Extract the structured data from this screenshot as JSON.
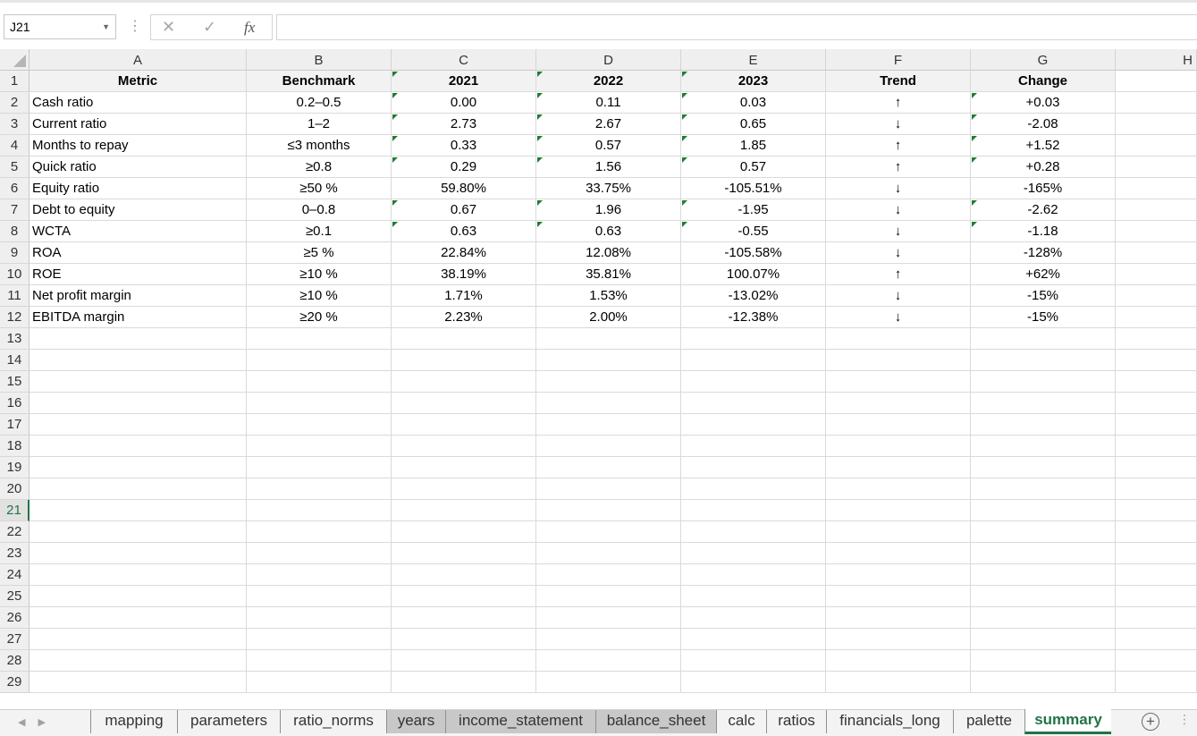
{
  "formula_bar": {
    "name_box": "J21",
    "formula": ""
  },
  "columns": [
    "A",
    "B",
    "C",
    "D",
    "E",
    "F",
    "G",
    "H"
  ],
  "header_row": [
    "Metric",
    "Benchmark",
    "2021",
    "2022",
    "2023",
    "Trend",
    "Change"
  ],
  "rows": [
    [
      "Cash ratio",
      "0.2–0.5",
      "0.00",
      "0.11",
      "0.03",
      "↑",
      "+0.03"
    ],
    [
      "Current ratio",
      "1–2",
      "2.73",
      "2.67",
      "0.65",
      "↓",
      "-2.08"
    ],
    [
      "Months to repay",
      "≤3 months",
      "0.33",
      "0.57",
      "1.85",
      "↑",
      "+1.52"
    ],
    [
      "Quick ratio",
      "≥0.8",
      "0.29",
      "1.56",
      "0.57",
      "↑",
      "+0.28"
    ],
    [
      "Equity ratio",
      "≥50 %",
      "59.80%",
      "33.75%",
      "-105.51%",
      "↓",
      "-165%"
    ],
    [
      "Debt to equity",
      "0–0.8",
      "0.67",
      "1.96",
      "-1.95",
      "↓",
      "-2.62"
    ],
    [
      "WCTA",
      "≥0.1",
      "0.63",
      "0.63",
      "-0.55",
      "↓",
      "-1.18"
    ],
    [
      "ROA",
      "≥5 %",
      "22.84%",
      "12.08%",
      "-105.58%",
      "↓",
      "-128%"
    ],
    [
      "ROE",
      "≥10 %",
      "38.19%",
      "35.81%",
      "100.07%",
      "↑",
      "+62%"
    ],
    [
      "Net profit margin",
      "≥10 %",
      "1.71%",
      "1.53%",
      "-13.02%",
      "↓",
      "-15%"
    ],
    [
      "EBITDA margin",
      "≥20 %",
      "2.23%",
      "2.00%",
      "-12.38%",
      "↓",
      "-15%"
    ]
  ],
  "row_numbers": [
    "1",
    "2",
    "3",
    "4",
    "5",
    "6",
    "7",
    "8",
    "9",
    "10",
    "11",
    "12",
    "13",
    "14",
    "15",
    "16",
    "17",
    "18",
    "19",
    "20",
    "21",
    "22",
    "23",
    "24",
    "25",
    "26",
    "27",
    "28",
    "29"
  ],
  "selected_row": "21",
  "sheet_tabs": [
    {
      "label": "mapping",
      "style": "normal"
    },
    {
      "label": "parameters",
      "style": "normal"
    },
    {
      "label": "ratio_norms",
      "style": "normal"
    },
    {
      "label": "years",
      "style": "grey"
    },
    {
      "label": "income_statement",
      "style": "grey"
    },
    {
      "label": "balance_sheet",
      "style": "grey"
    },
    {
      "label": "calc",
      "style": "normal"
    },
    {
      "label": "ratios",
      "style": "normal"
    },
    {
      "label": "financials_long",
      "style": "normal"
    },
    {
      "label": "palette",
      "style": "normal"
    },
    {
      "label": "summary",
      "style": "active"
    }
  ],
  "icons": {
    "cancel": "✕",
    "enter": "✓",
    "function": "fx",
    "add_sheet": "+"
  },
  "colors": {
    "accent": "#217346",
    "error_flag": "#1e7d32"
  }
}
